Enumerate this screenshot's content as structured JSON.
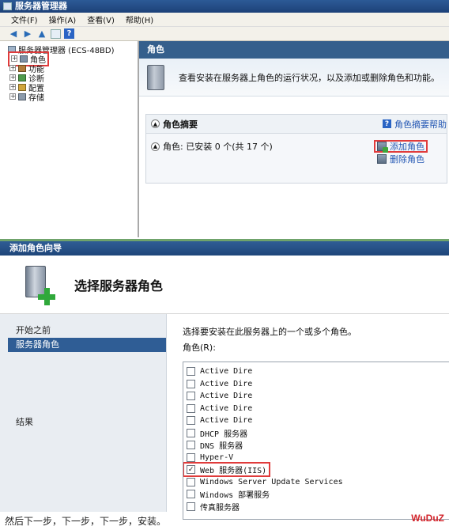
{
  "server_manager": {
    "title": "服务器管理器",
    "menu": [
      "文件(F)",
      "操作(A)",
      "查看(V)",
      "帮助(H)"
    ],
    "tree": {
      "root": "服务器管理器 (ECS-48BD)",
      "items": [
        "角色",
        "功能",
        "诊断",
        "配置",
        "存储"
      ]
    },
    "panel_title": "角色",
    "description": "查看安装在服务器上角色的运行状况，以及添加或删除角色和功能。",
    "summary_title": "角色摘要",
    "summary_help": "角色摘要帮助",
    "roles_count": "角色: 已安装 0 个(共 17 个)",
    "actions": {
      "add": "添加角色",
      "remove": "删除角色"
    }
  },
  "wizard": {
    "title": "添加角色向导",
    "heading": "选择服务器角色",
    "steps": [
      "开始之前",
      "服务器角色",
      "",
      "",
      "结果"
    ],
    "instruction": "选择要安装在此服务器上的一个或多个角色。",
    "roles_label": "角色(R):",
    "roles": [
      {
        "label": "Active Dire",
        "checked": false
      },
      {
        "label": "Active Dire",
        "checked": false
      },
      {
        "label": "Active Dire",
        "checked": false
      },
      {
        "label": "Active Dire",
        "checked": false
      },
      {
        "label": "Active Dire",
        "checked": false
      },
      {
        "label": "DHCP 服务器",
        "checked": false
      },
      {
        "label": "DNS 服务器",
        "checked": false
      },
      {
        "label": "Hyper-V",
        "checked": false
      },
      {
        "label": "Web 服务器(IIS)",
        "checked": true
      },
      {
        "label": "Windows Server Update Services",
        "checked": false
      },
      {
        "label": "Windows 部署服务",
        "checked": false
      },
      {
        "label": "传真服务器",
        "checked": false
      }
    ]
  },
  "caption": "然后下一步，下一步，下一步，安装。",
  "brand": "WuDuZ",
  "colors": {
    "title_bar": "#1e4579",
    "highlight_box": "#e03b3b",
    "link": "#2256b3",
    "brand": "#d2232a",
    "selected_step": "#2f5d95"
  }
}
